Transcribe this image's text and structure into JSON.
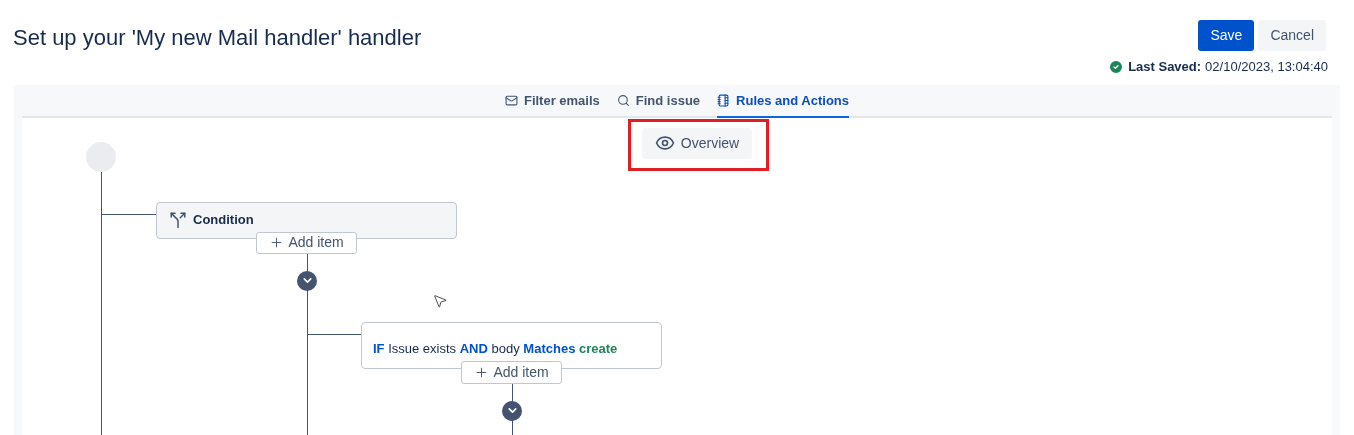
{
  "title": "Set up your 'My new Mail handler' handler",
  "actions": [
    {
      "label": "Save",
      "kind": "primary"
    },
    {
      "label": "Cancel",
      "kind": "secondary"
    }
  ],
  "last_saved": {
    "label": "Last Saved:",
    "value": "02/10/2023, 13:04:40"
  },
  "tabs": [
    {
      "label": "Filter emails",
      "selected": false
    },
    {
      "label": "Find issue",
      "selected": false
    },
    {
      "label": "Rules and Actions",
      "selected": true
    }
  ],
  "canvas": {
    "overview_button": {
      "label": "Overview",
      "highlighted": true
    },
    "condition": {
      "label": "Condition",
      "add_label": "Add item"
    },
    "rule": {
      "tokens": [
        {
          "text": "IF",
          "kind": "keyword"
        },
        {
          "text": "Issue exists",
          "kind": "plain"
        },
        {
          "text": "AND",
          "kind": "keyword"
        },
        {
          "text": "body",
          "kind": "plain"
        },
        {
          "text": "Matches",
          "kind": "keyword"
        },
        {
          "text": "create",
          "kind": "value"
        }
      ],
      "add_label": "Add item"
    }
  }
}
